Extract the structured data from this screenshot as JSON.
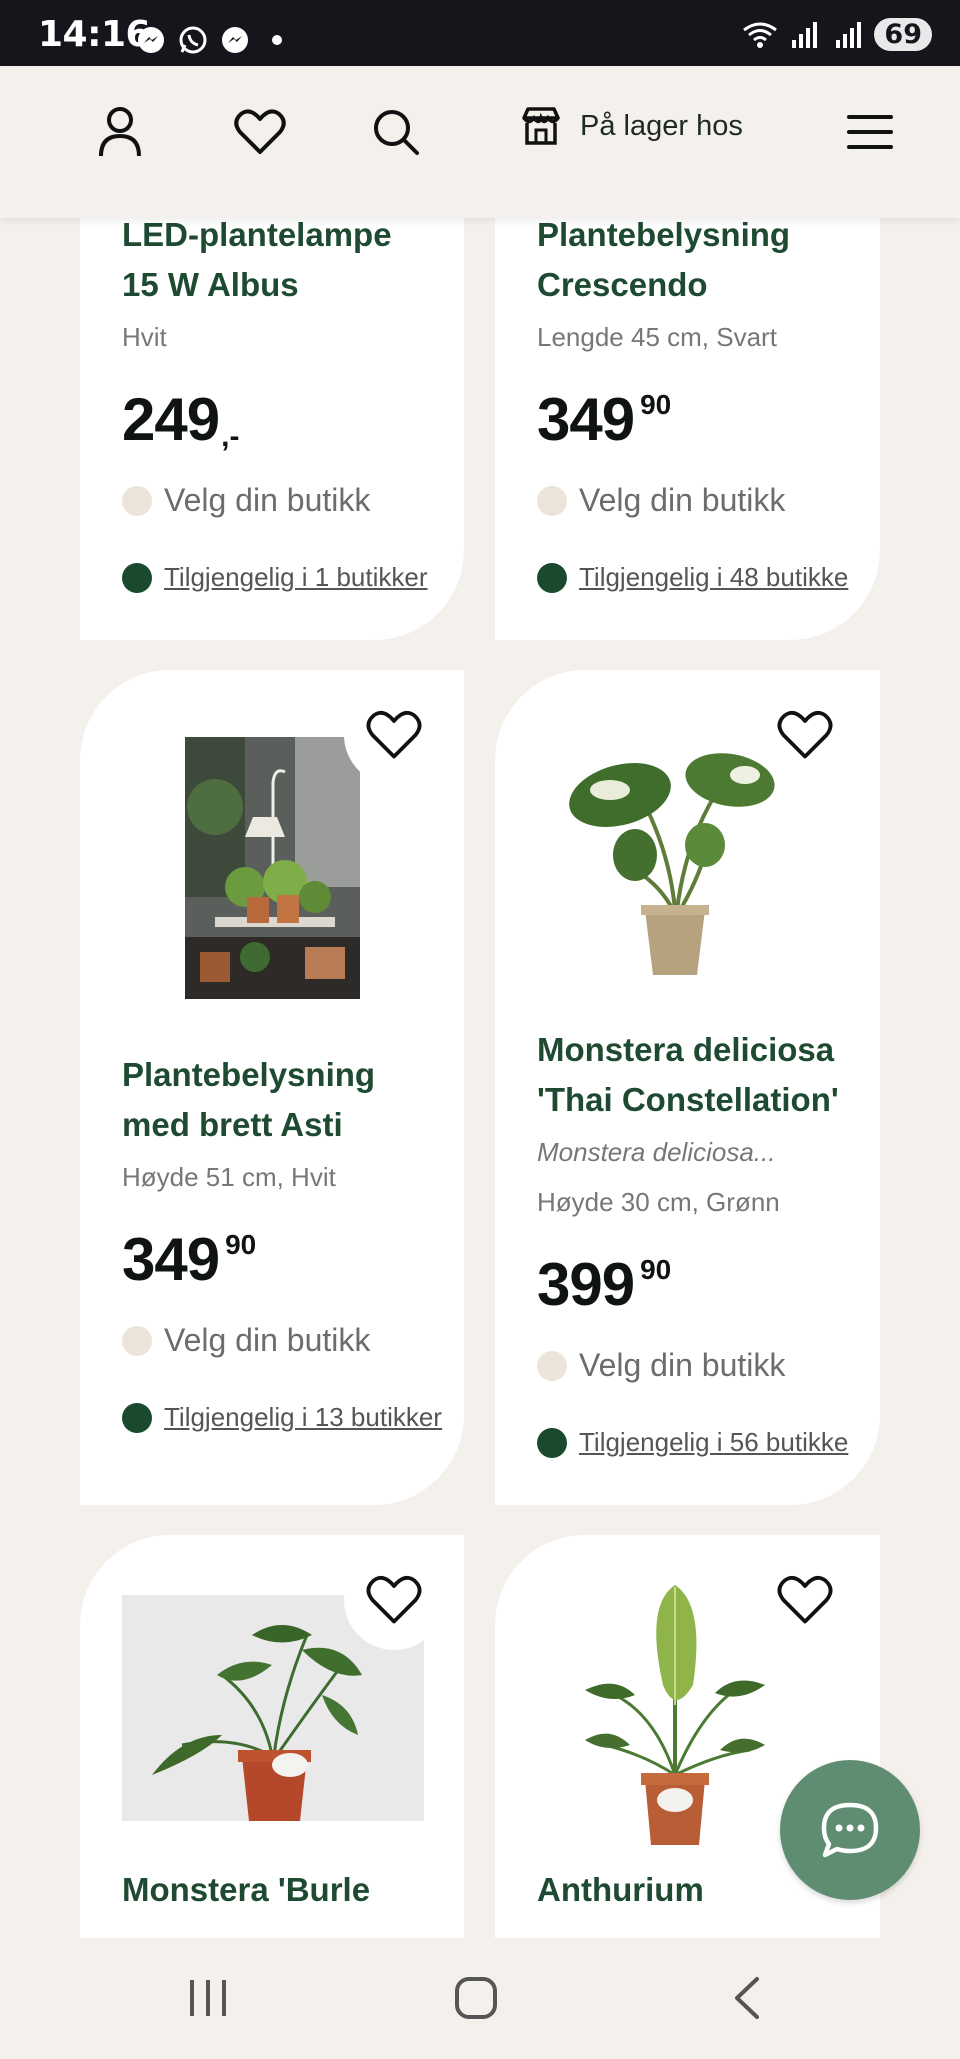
{
  "status_bar": {
    "time": "14:16",
    "battery": "69",
    "apps": [
      "messenger-icon",
      "whatsapp-icon",
      "messenger-icon",
      "dot"
    ]
  },
  "header": {
    "store_label": "På lager hos",
    "icons": [
      "user-icon",
      "heart-icon",
      "search-icon",
      "store-icon",
      "menu-icon"
    ]
  },
  "products": [
    {
      "title_lines": [
        "LED-plantelampe",
        "15 W Albus"
      ],
      "variant": "Hvit",
      "price_main": "249",
      "price_suffix": ",-",
      "store_prompt": "Velg din butikk",
      "availability": "Tilgjengelig i 1 butikker"
    },
    {
      "title_lines": [
        "Plantebelysning",
        "Crescendo"
      ],
      "variant": "Lengde 45 cm, Svart",
      "price_main": "349",
      "price_dec": "90",
      "store_prompt": "Velg din butikk",
      "availability": "Tilgjengelig i 48 butikke"
    },
    {
      "title_lines": [
        "Plantebelysning",
        "med brett Asti"
      ],
      "variant": "Høyde 51 cm, Hvit",
      "price_main": "349",
      "price_dec": "90",
      "store_prompt": "Velg din butikk",
      "availability": "Tilgjengelig i 13 butikker"
    },
    {
      "title_lines": [
        "Monstera deliciosa",
        "'Thai Constellation'"
      ],
      "latin": "Monstera deliciosa...",
      "variant": "Høyde 30 cm, Grønn",
      "price_main": "399",
      "price_dec": "90",
      "store_prompt": "Velg din butikk",
      "availability": "Tilgjengelig i 56 butikke"
    },
    {
      "title_lines": [
        "Monstera 'Burle"
      ]
    },
    {
      "title_lines": [
        "Anthurium"
      ]
    }
  ],
  "colors": {
    "background": "#f4f0ec",
    "title_green": "#1e4a32",
    "chat_button": "#5e8d72",
    "available_dot": "#1a4a2e",
    "store_dot": "#ece3d9"
  }
}
